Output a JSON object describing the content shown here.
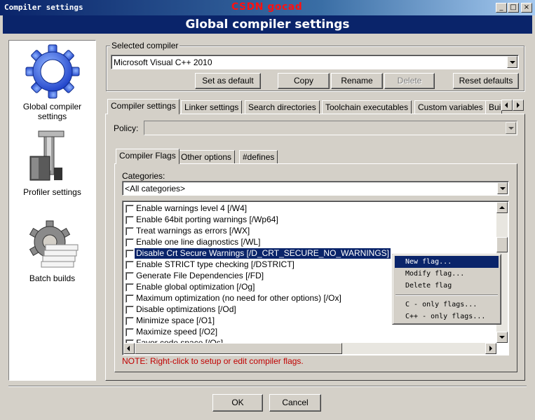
{
  "window": {
    "title": "Compiler settings",
    "watermark": "CSDN gocad",
    "controls": [
      "_",
      "□",
      "×"
    ]
  },
  "header": {
    "title": "Global compiler settings"
  },
  "sidebar": {
    "items": [
      {
        "label": "Global compiler settings",
        "icon": "gear-icon",
        "selected": true
      },
      {
        "label": "Profiler settings",
        "icon": "caliper-icon"
      },
      {
        "label": "Batch builds",
        "icon": "gear-stack-icon"
      }
    ]
  },
  "selected_compiler": {
    "group_label": "Selected compiler",
    "value": "Microsoft Visual C++ 2010",
    "buttons": {
      "set_default": "Set as default",
      "copy": "Copy",
      "rename": "Rename",
      "delete": "Delete",
      "reset": "Reset defaults"
    }
  },
  "tabs": [
    "Compiler settings",
    "Linker settings",
    "Search directories",
    "Toolchain executables",
    "Custom variables",
    "Bui"
  ],
  "policy": {
    "label": "Policy:",
    "value": ""
  },
  "subtabs": [
    "Compiler Flags",
    "Other options",
    "#defines"
  ],
  "categories": {
    "label": "Categories:",
    "value": "<All categories>"
  },
  "flags": [
    {
      "label": "Enable warnings level 4  [/W4]",
      "checked": false
    },
    {
      "label": "Enable 64bit porting warnings  [/Wp64]",
      "checked": false
    },
    {
      "label": "Treat warnings as errors  [/WX]",
      "checked": false
    },
    {
      "label": "Enable one line diagnostics  [/WL]",
      "checked": false
    },
    {
      "label": "Disable Crt Secure Warnings  [/D_CRT_SECURE_NO_WARNINGS]",
      "checked": false,
      "selected": true
    },
    {
      "label": "Enable STRICT type checking  [/DSTRICT]",
      "checked": false
    },
    {
      "label": "Generate File Dependencies  [/FD]",
      "checked": false
    },
    {
      "label": "Enable global optimization  [/Og]",
      "checked": false
    },
    {
      "label": "Maximum optimization (no need for other options)  [/Ox]",
      "checked": false
    },
    {
      "label": "Disable optimizations  [/Od]",
      "checked": false
    },
    {
      "label": "Minimize space  [/O1]",
      "checked": false
    },
    {
      "label": "Maximize speed  [/O2]",
      "checked": false
    },
    {
      "label": "Favor code space  [/Os]",
      "checked": false
    }
  ],
  "note": "NOTE: Right-click to setup or edit compiler flags.",
  "context_menu": {
    "items": [
      "New flag...",
      "Modify flag...",
      "Delete flag",
      "C - only flags...",
      "C++ - only flags..."
    ]
  },
  "footer": {
    "ok": "OK",
    "cancel": "Cancel"
  },
  "colors": {
    "title_blue": "#0a246a",
    "note_red": "#c00000",
    "watermark_red": "#ff1010",
    "face": "#d4d0c8"
  }
}
